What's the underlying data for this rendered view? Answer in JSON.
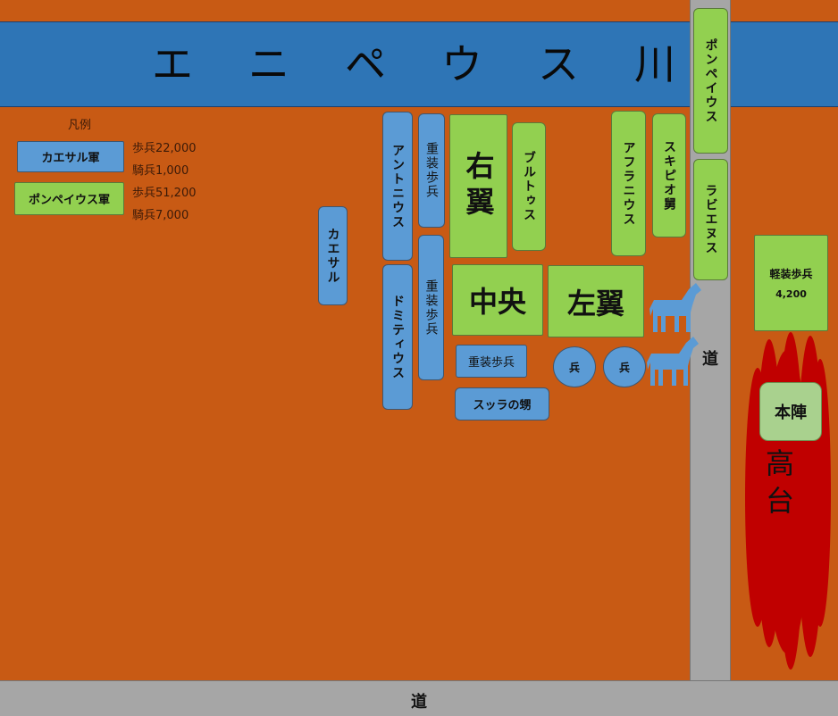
{
  "river": {
    "title": "エニペウス川"
  },
  "legend": {
    "title": "凡例",
    "caesar": {
      "label": "カエサル軍",
      "infantry": "歩兵22,000",
      "cavalry": "騎兵1,000"
    },
    "pompey": {
      "label": "ポンペイウス軍",
      "infantry": "歩兵51,200",
      "cavalry": "騎兵7,000"
    }
  },
  "caesar_units": {
    "caesar": "カエサル",
    "antonius": "アントニウス",
    "domitius": "ドミティウス",
    "heavy_infantry_1": "重装歩兵",
    "heavy_infantry_2": "重装歩兵",
    "heavy_infantry_3": "重装歩兵",
    "sulla": "スッラの甥",
    "soldier_1": "兵",
    "soldier_2": "兵"
  },
  "pompey_units": {
    "right_wing": "右翼",
    "center": "中央",
    "left_wing": "左翼",
    "brutus": "ブルトゥス",
    "afranius": "アフラニウス",
    "scipio": "スキピオ舅",
    "pompeius": "ポンペイウス",
    "labienus": "ラビエヌス",
    "light_infantry": "軽装歩兵",
    "light_infantry_count": "4,200",
    "headquarters": "本陣"
  },
  "terrain": {
    "hill": "高台",
    "road_vertical": "道",
    "road_horizontal": "道"
  },
  "colors": {
    "background": "#c85a14",
    "river": "#2e75b6",
    "caesar": "#5b9bd5",
    "pompey": "#92d050",
    "road": "#a6a6a6",
    "hill": "#c00000"
  },
  "icons": [
    "horse-icon",
    "horse-icon"
  ]
}
